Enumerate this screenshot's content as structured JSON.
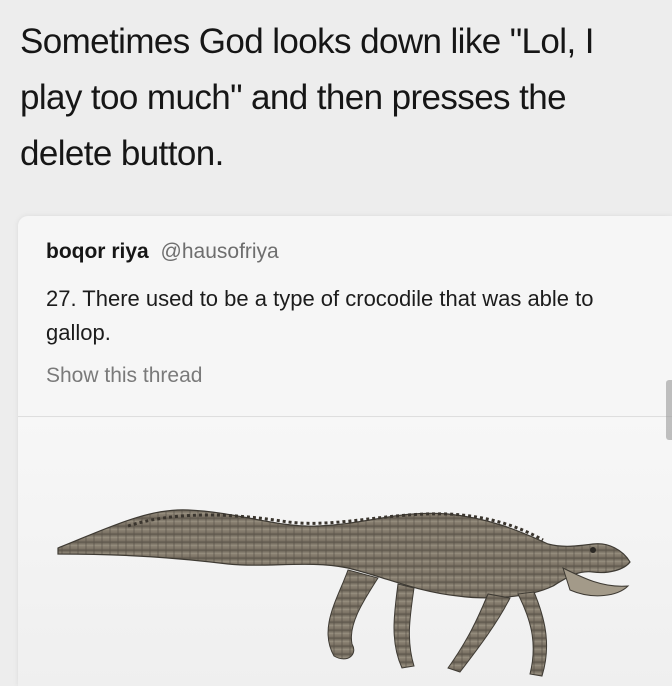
{
  "caption": "Sometimes God looks down like \"Lol, I play too much\" and then presses the delete button.",
  "tweet": {
    "author_name": "boqor riya",
    "author_handle": "@hausofriya",
    "text": "27. There used to be a type of crocodile that was able to gallop.",
    "show_thread": "Show this thread"
  },
  "media": {
    "image_subject": "galloping-crocodile-illustration"
  }
}
